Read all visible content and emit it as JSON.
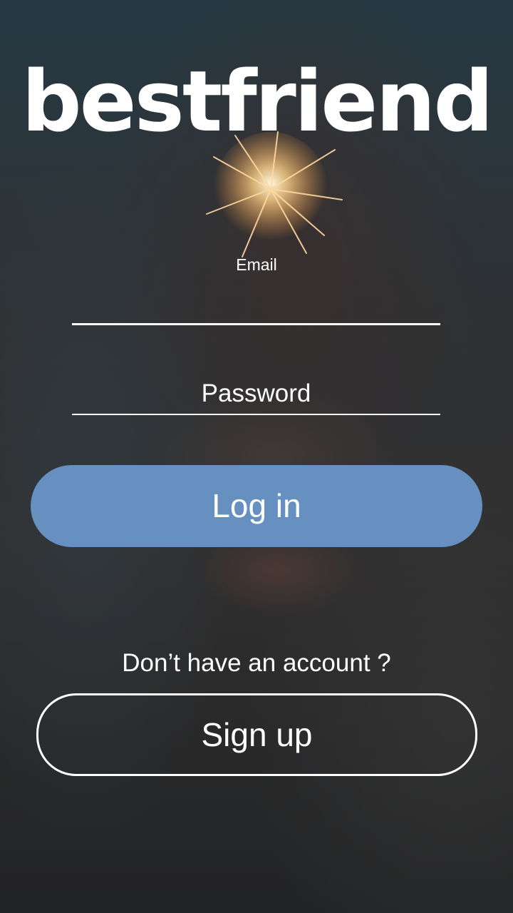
{
  "app": {
    "logo_text": "bestfriend"
  },
  "login_form": {
    "email_label": "Email",
    "email_value": "",
    "password_placeholder": "Password",
    "login_label": "Log in"
  },
  "signup": {
    "prompt": "Don’t have an account ?",
    "button_label": "Sign up"
  },
  "colors": {
    "login_button": "#6590bf",
    "text": "#ffffff"
  }
}
